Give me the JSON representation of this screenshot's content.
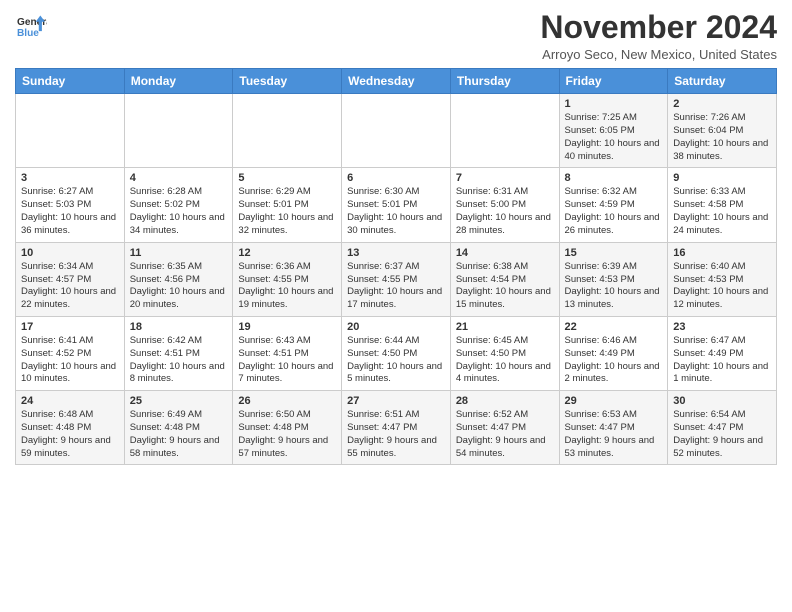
{
  "header": {
    "logo_line1": "General",
    "logo_line2": "Blue",
    "title": "November 2024",
    "location": "Arroyo Seco, New Mexico, United States"
  },
  "weekdays": [
    "Sunday",
    "Monday",
    "Tuesday",
    "Wednesday",
    "Thursday",
    "Friday",
    "Saturday"
  ],
  "weeks": [
    [
      {
        "day": "",
        "info": ""
      },
      {
        "day": "",
        "info": ""
      },
      {
        "day": "",
        "info": ""
      },
      {
        "day": "",
        "info": ""
      },
      {
        "day": "",
        "info": ""
      },
      {
        "day": "1",
        "info": "Sunrise: 7:25 AM\nSunset: 6:05 PM\nDaylight: 10 hours and 40 minutes."
      },
      {
        "day": "2",
        "info": "Sunrise: 7:26 AM\nSunset: 6:04 PM\nDaylight: 10 hours and 38 minutes."
      }
    ],
    [
      {
        "day": "3",
        "info": "Sunrise: 6:27 AM\nSunset: 5:03 PM\nDaylight: 10 hours and 36 minutes."
      },
      {
        "day": "4",
        "info": "Sunrise: 6:28 AM\nSunset: 5:02 PM\nDaylight: 10 hours and 34 minutes."
      },
      {
        "day": "5",
        "info": "Sunrise: 6:29 AM\nSunset: 5:01 PM\nDaylight: 10 hours and 32 minutes."
      },
      {
        "day": "6",
        "info": "Sunrise: 6:30 AM\nSunset: 5:01 PM\nDaylight: 10 hours and 30 minutes."
      },
      {
        "day": "7",
        "info": "Sunrise: 6:31 AM\nSunset: 5:00 PM\nDaylight: 10 hours and 28 minutes."
      },
      {
        "day": "8",
        "info": "Sunrise: 6:32 AM\nSunset: 4:59 PM\nDaylight: 10 hours and 26 minutes."
      },
      {
        "day": "9",
        "info": "Sunrise: 6:33 AM\nSunset: 4:58 PM\nDaylight: 10 hours and 24 minutes."
      }
    ],
    [
      {
        "day": "10",
        "info": "Sunrise: 6:34 AM\nSunset: 4:57 PM\nDaylight: 10 hours and 22 minutes."
      },
      {
        "day": "11",
        "info": "Sunrise: 6:35 AM\nSunset: 4:56 PM\nDaylight: 10 hours and 20 minutes."
      },
      {
        "day": "12",
        "info": "Sunrise: 6:36 AM\nSunset: 4:55 PM\nDaylight: 10 hours and 19 minutes."
      },
      {
        "day": "13",
        "info": "Sunrise: 6:37 AM\nSunset: 4:55 PM\nDaylight: 10 hours and 17 minutes."
      },
      {
        "day": "14",
        "info": "Sunrise: 6:38 AM\nSunset: 4:54 PM\nDaylight: 10 hours and 15 minutes."
      },
      {
        "day": "15",
        "info": "Sunrise: 6:39 AM\nSunset: 4:53 PM\nDaylight: 10 hours and 13 minutes."
      },
      {
        "day": "16",
        "info": "Sunrise: 6:40 AM\nSunset: 4:53 PM\nDaylight: 10 hours and 12 minutes."
      }
    ],
    [
      {
        "day": "17",
        "info": "Sunrise: 6:41 AM\nSunset: 4:52 PM\nDaylight: 10 hours and 10 minutes."
      },
      {
        "day": "18",
        "info": "Sunrise: 6:42 AM\nSunset: 4:51 PM\nDaylight: 10 hours and 8 minutes."
      },
      {
        "day": "19",
        "info": "Sunrise: 6:43 AM\nSunset: 4:51 PM\nDaylight: 10 hours and 7 minutes."
      },
      {
        "day": "20",
        "info": "Sunrise: 6:44 AM\nSunset: 4:50 PM\nDaylight: 10 hours and 5 minutes."
      },
      {
        "day": "21",
        "info": "Sunrise: 6:45 AM\nSunset: 4:50 PM\nDaylight: 10 hours and 4 minutes."
      },
      {
        "day": "22",
        "info": "Sunrise: 6:46 AM\nSunset: 4:49 PM\nDaylight: 10 hours and 2 minutes."
      },
      {
        "day": "23",
        "info": "Sunrise: 6:47 AM\nSunset: 4:49 PM\nDaylight: 10 hours and 1 minute."
      }
    ],
    [
      {
        "day": "24",
        "info": "Sunrise: 6:48 AM\nSunset: 4:48 PM\nDaylight: 9 hours and 59 minutes."
      },
      {
        "day": "25",
        "info": "Sunrise: 6:49 AM\nSunset: 4:48 PM\nDaylight: 9 hours and 58 minutes."
      },
      {
        "day": "26",
        "info": "Sunrise: 6:50 AM\nSunset: 4:48 PM\nDaylight: 9 hours and 57 minutes."
      },
      {
        "day": "27",
        "info": "Sunrise: 6:51 AM\nSunset: 4:47 PM\nDaylight: 9 hours and 55 minutes."
      },
      {
        "day": "28",
        "info": "Sunrise: 6:52 AM\nSunset: 4:47 PM\nDaylight: 9 hours and 54 minutes."
      },
      {
        "day": "29",
        "info": "Sunrise: 6:53 AM\nSunset: 4:47 PM\nDaylight: 9 hours and 53 minutes."
      },
      {
        "day": "30",
        "info": "Sunrise: 6:54 AM\nSunset: 4:47 PM\nDaylight: 9 hours and 52 minutes."
      }
    ]
  ]
}
